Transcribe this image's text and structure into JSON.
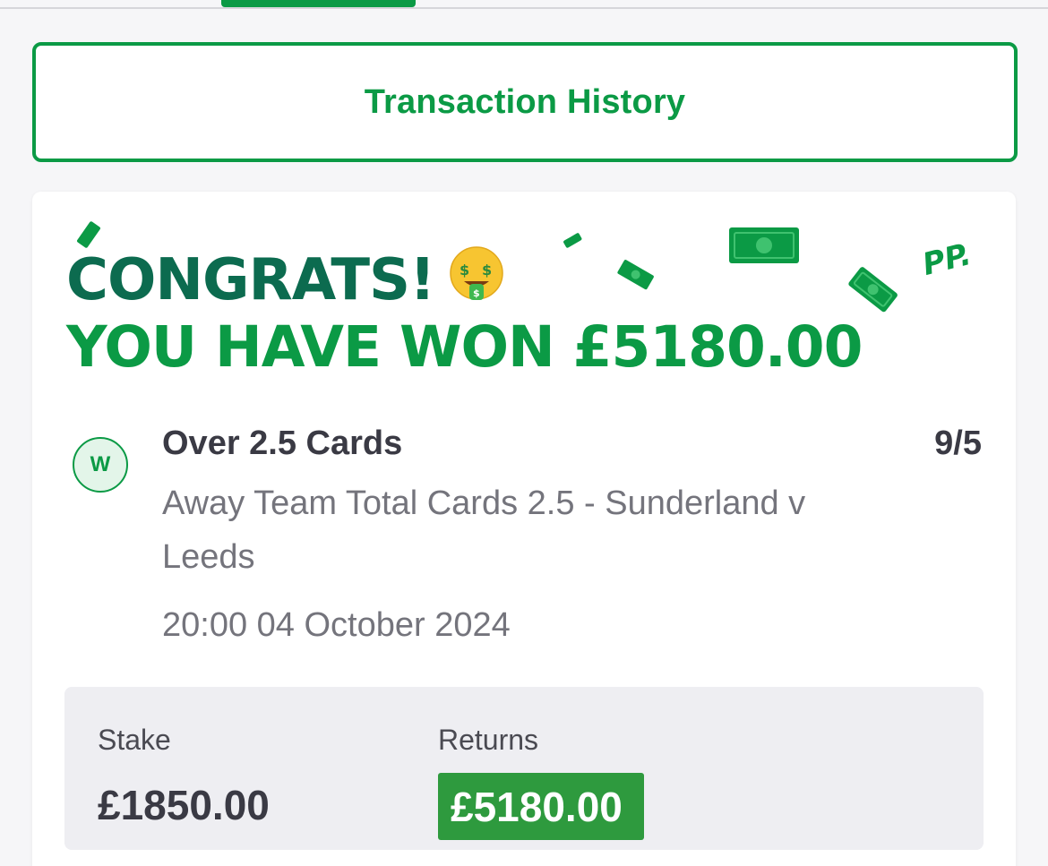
{
  "tabs": {
    "active_tab": "selected"
  },
  "header": {
    "transaction_history_label": "Transaction History"
  },
  "banner": {
    "congrats_text": "CONGRATS!",
    "won_text": "YOU HAVE WON £5180.00",
    "emoji": "money-mouth-face-icon",
    "logo_text": "PP."
  },
  "bet": {
    "status": "W",
    "selection": "Over 2.5 Cards",
    "odds": "9/5",
    "market": "Away Team Total Cards 2.5 - Sunderland v Leeds",
    "datetime": "20:00 04 October 2024"
  },
  "summary": {
    "stake_label": "Stake",
    "stake_value": "£1850.00",
    "returns_label": "Returns",
    "returns_value": "£5180.00"
  },
  "colors": {
    "brand_green": "#0b9a45",
    "dark_green": "#0c6b4f",
    "returns_green": "#2e9a3e"
  }
}
